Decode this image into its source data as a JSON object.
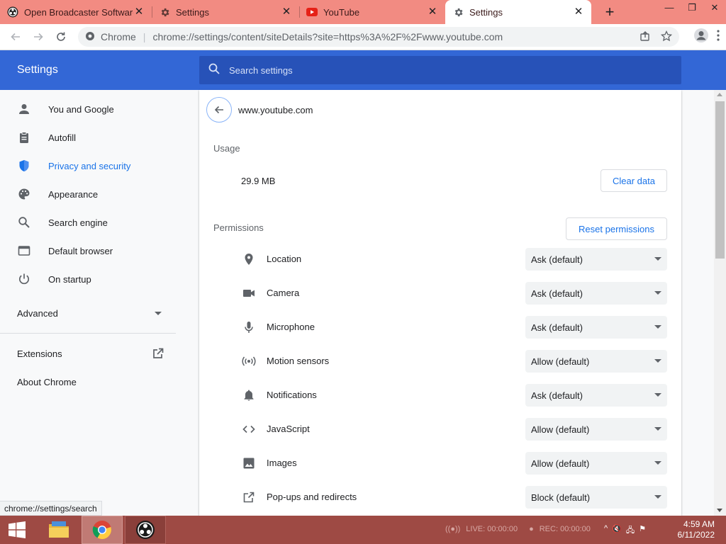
{
  "tabs": [
    {
      "title": "Open Broadcaster Software",
      "icon": "obs-icon"
    },
    {
      "title": "Settings",
      "icon": "gear-icon"
    },
    {
      "title": "YouTube",
      "icon": "youtube-icon"
    },
    {
      "title": "Settings",
      "icon": "gear-icon",
      "active": true
    }
  ],
  "omnibox": {
    "chrome_label": "Chrome",
    "separator": "|",
    "url": "chrome://settings/content/siteDetails?site=https%3A%2F%2Fwww.youtube.com"
  },
  "header": {
    "title": "Settings",
    "search_placeholder": "Search settings"
  },
  "sidebar": {
    "items": [
      {
        "label": "You and Google",
        "icon": "person-icon"
      },
      {
        "label": "Autofill",
        "icon": "clipboard-icon"
      },
      {
        "label": "Privacy and security",
        "icon": "shield-icon",
        "active": true
      },
      {
        "label": "Appearance",
        "icon": "palette-icon"
      },
      {
        "label": "Search engine",
        "icon": "search-icon"
      },
      {
        "label": "Default browser",
        "icon": "browser-icon"
      },
      {
        "label": "On startup",
        "icon": "power-icon"
      }
    ],
    "advanced": "Advanced",
    "extensions": "Extensions",
    "about": "About Chrome"
  },
  "site": {
    "name": "www.youtube.com",
    "usage_label": "Usage",
    "usage_value": "29.9 MB",
    "clear_data": "Clear data",
    "permissions_label": "Permissions",
    "reset_permissions": "Reset permissions",
    "permissions": [
      {
        "label": "Location",
        "value": "Ask (default)",
        "icon": "location-pin-icon"
      },
      {
        "label": "Camera",
        "value": "Ask (default)",
        "icon": "camera-icon"
      },
      {
        "label": "Microphone",
        "value": "Ask (default)",
        "icon": "microphone-icon"
      },
      {
        "label": "Motion sensors",
        "value": "Allow (default)",
        "icon": "motion-sensor-icon"
      },
      {
        "label": "Notifications",
        "value": "Ask (default)",
        "icon": "bell-icon"
      },
      {
        "label": "JavaScript",
        "value": "Allow (default)",
        "icon": "code-icon"
      },
      {
        "label": "Images",
        "value": "Allow (default)",
        "icon": "image-icon"
      },
      {
        "label": "Pop-ups and redirects",
        "value": "Block (default)",
        "icon": "open-in-new-icon"
      }
    ]
  },
  "status_url": "chrome://settings/search",
  "taskbar": {
    "obs_live": "LIVE: 00:00:00",
    "obs_rec": "REC: 00:00:00",
    "clock_time": "4:59 AM",
    "clock_date": "6/11/2022"
  },
  "colors": {
    "accent": "#1a73e8",
    "header": "#3367d6",
    "tabstrip": "#f28b82",
    "taskbar": "#9e4a44"
  }
}
